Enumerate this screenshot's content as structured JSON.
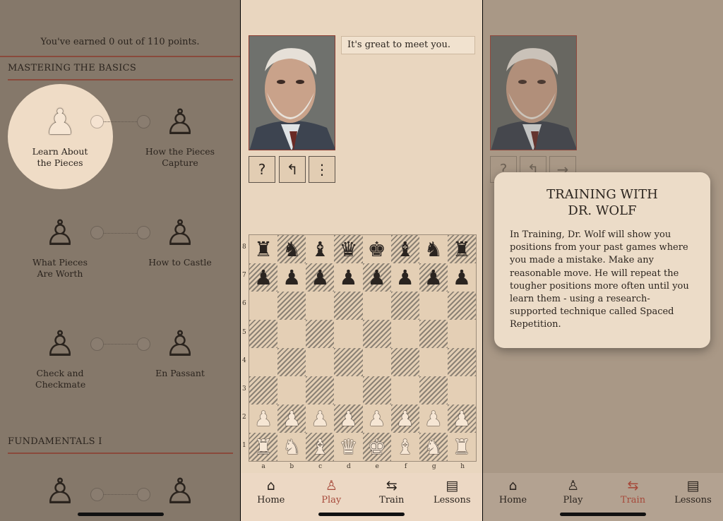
{
  "lessons_screen": {
    "points_text": "You've earned 0 out of 110 points.",
    "sections": [
      {
        "title": "MASTERING THE BASICS",
        "lessons": [
          "Learn About the Pieces",
          "How the Pieces Capture",
          "What Pieces Are Worth",
          "How to Castle",
          "Check and Checkmate",
          "En Passant"
        ]
      },
      {
        "title": "FUNDAMENTALS I",
        "lessons": [
          "",
          ""
        ]
      }
    ],
    "selected_lesson": "Learn About the Pieces"
  },
  "play_screen": {
    "speech": "It's great to meet you.",
    "buttons": {
      "hint": "?",
      "undo": "↰",
      "menu": "⋮"
    },
    "board": {
      "ranks": [
        "8",
        "7",
        "6",
        "5",
        "4",
        "3",
        "2",
        "1"
      ],
      "files": [
        "a",
        "b",
        "c",
        "d",
        "e",
        "f",
        "g",
        "h"
      ],
      "position": [
        "rnbqkbnr",
        "pppppppp",
        "........",
        "........",
        "........",
        "........",
        "PPPPPPPP",
        "RNBQKBNR"
      ]
    }
  },
  "train_screen": {
    "buttons": {
      "hint": "?",
      "undo": "↰",
      "next": "→"
    },
    "dialog": {
      "title_line1": "TRAINING WITH",
      "title_line2": "DR. WOLF",
      "body": "In Training, Dr. Wolf will show you positions from your past games where you made a mistake. Make any reasonable move. He will repeat the tougher positions more often until you learn them - using a research-supported technique called Spaced Repetition."
    }
  },
  "tabbar": {
    "items": [
      {
        "label": "Home",
        "icon": "house-icon"
      },
      {
        "label": "Play",
        "icon": "pawn-icon"
      },
      {
        "label": "Train",
        "icon": "repeat-arrows-icon"
      },
      {
        "label": "Lessons",
        "icon": "book-icon"
      }
    ],
    "play_screen_active": "Play",
    "train_screen_active": "Train"
  },
  "colors": {
    "accent": "#a6493a",
    "rule": "#8a4a3c",
    "paper": "#e9d6bf"
  }
}
